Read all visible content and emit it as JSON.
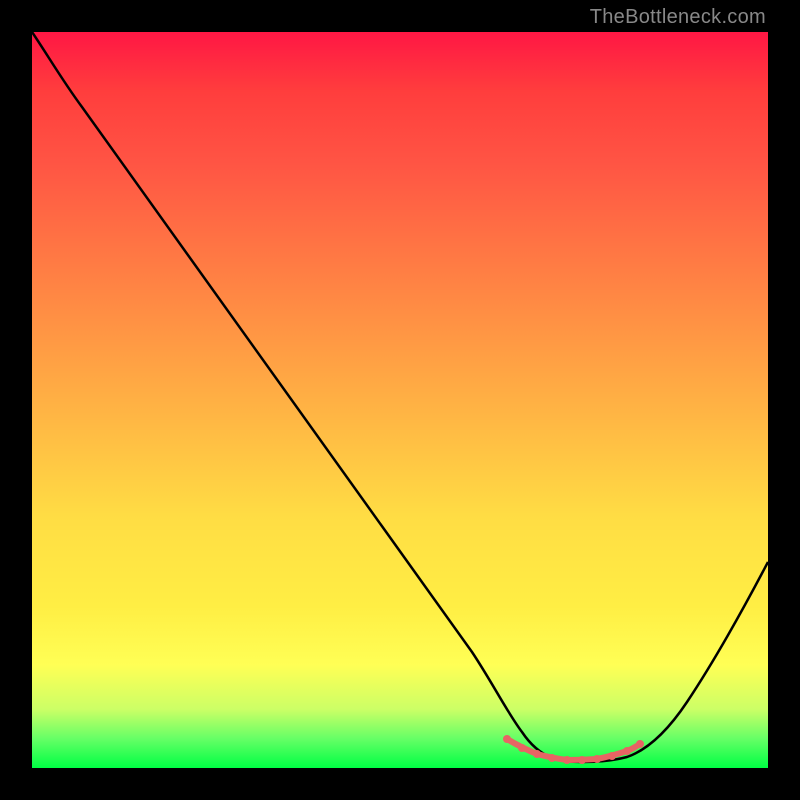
{
  "watermark": "TheBottleneck.com",
  "chart_data": {
    "type": "line",
    "title": "",
    "xlabel": "",
    "ylabel": "",
    "xlim": [
      0,
      100
    ],
    "ylim": [
      0,
      100
    ],
    "grid": false,
    "legend": false,
    "series": [
      {
        "name": "curve",
        "x": [
          0,
          3,
          6,
          10,
          20,
          30,
          40,
          50,
          60,
          63,
          66,
          70,
          74,
          78,
          82,
          86,
          90,
          95,
          100
        ],
        "y": [
          100,
          97,
          94,
          90,
          76,
          62,
          48,
          34,
          20,
          14,
          8,
          3,
          1,
          0,
          0,
          1,
          4,
          14,
          28
        ]
      },
      {
        "name": "bottom-marker",
        "x": [
          63,
          66,
          69,
          72,
          75,
          78,
          81,
          84
        ],
        "y": [
          3,
          2,
          1.5,
          1,
          1,
          1,
          1.5,
          2.5
        ]
      }
    ],
    "colors": {
      "curve": "#000000",
      "marker": "#e86464",
      "gradient_top": "#ff1744",
      "gradient_bottom": "#00ff44"
    }
  }
}
